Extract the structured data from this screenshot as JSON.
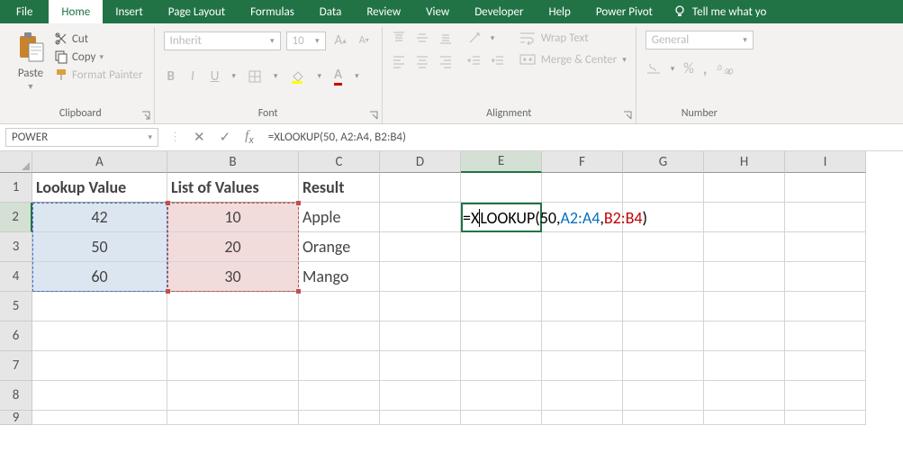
{
  "ribbon": {
    "tabs": [
      "File",
      "Home",
      "Insert",
      "Page Layout",
      "Formulas",
      "Data",
      "Review",
      "View",
      "Developer",
      "Help",
      "Power Pivot"
    ],
    "active_tab": "Home",
    "tell_me": "Tell me what yo"
  },
  "clipboard": {
    "label": "Clipboard",
    "paste": "Paste",
    "cut": "Cut",
    "copy": "Copy",
    "format_painter": "Format Painter"
  },
  "font": {
    "label": "Font",
    "name": "Inherit",
    "size": "10",
    "bold": "B",
    "italic": "I",
    "underline": "U"
  },
  "alignment": {
    "label": "Alignment",
    "wrap": "Wrap Text",
    "merge": "Merge & Center"
  },
  "number": {
    "label": "Number",
    "format": "General",
    "percent": "%",
    "comma": ","
  },
  "namebox": "POWER",
  "formula_bar": "=XLOOKUP(50, A2:A4, B2:B4)",
  "columns": [
    "A",
    "B",
    "C",
    "D",
    "E",
    "F",
    "G",
    "H",
    "I"
  ],
  "active_col_index": 4,
  "rows": [
    "1",
    "2",
    "3",
    "4",
    "5",
    "6",
    "7",
    "8",
    "9"
  ],
  "headers": {
    "A": "Lookup Value",
    "B": "List of Values",
    "C": "Result"
  },
  "data": {
    "A": [
      "42",
      "50",
      "60"
    ],
    "B": [
      "10",
      "20",
      "30"
    ],
    "C": [
      "Apple",
      "Orange",
      "Mango"
    ]
  },
  "edit_formula": {
    "pre": "=X",
    "func": "LOOKUP(",
    "arg1": "50, ",
    "arg2": "A2:A4",
    "sep": ", ",
    "arg3": "B2:B4",
    "close": ")"
  },
  "colors": {
    "blue_range": "#4472c4",
    "red_range": "#c0504d",
    "accent": "#217346"
  }
}
